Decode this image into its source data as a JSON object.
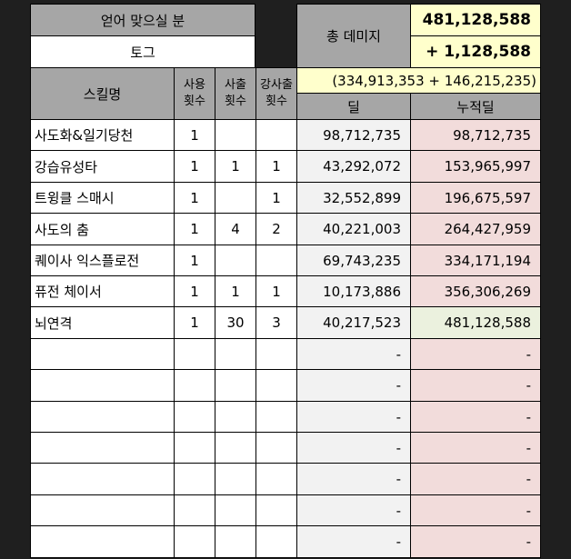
{
  "top_left": {
    "title": "얻어 맞으실 분",
    "name": "토그"
  },
  "summary": {
    "total_label": "총 데미지",
    "total_value": "481,128,588",
    "delta_value": "+ 1,128,588",
    "breakdown": "(334,913,353 + 146,215,235)"
  },
  "headers": {
    "skill": "스킬명",
    "use_line1": "사용",
    "use_line2": "횟수",
    "cast_line1": "사출",
    "cast_line2": "횟수",
    "strong_line1": "강사출",
    "strong_line2": "횟수",
    "deal": "딜",
    "cumulative": "누적딜"
  },
  "rows": [
    {
      "skill": "사도화&일기당천",
      "use": "1",
      "cast": "",
      "strong": "",
      "deal": "98,712,735",
      "cum": "98,712,735"
    },
    {
      "skill": "강습유성타",
      "use": "1",
      "cast": "1",
      "strong": "1",
      "deal": "43,292,072",
      "cum": "153,965,997"
    },
    {
      "skill": "트윙클 스매시",
      "use": "1",
      "cast": "",
      "strong": "1",
      "deal": "32,552,899",
      "cum": "196,675,597"
    },
    {
      "skill": "사도의 춤",
      "use": "1",
      "cast": "4",
      "strong": "2",
      "deal": "40,221,003",
      "cum": "264,427,959"
    },
    {
      "skill": "퀘이사 익스플로전",
      "use": "1",
      "cast": "",
      "strong": "",
      "deal": "69,743,235",
      "cum": "334,171,194"
    },
    {
      "skill": "퓨전 체이서",
      "use": "1",
      "cast": "1",
      "strong": "1",
      "deal": "10,173,886",
      "cum": "356,306,269"
    },
    {
      "skill": "뇌연격",
      "use": "1",
      "cast": "30",
      "strong": "3",
      "deal": "40,217,523",
      "cum": "481,128,588"
    },
    {
      "skill": "",
      "use": "",
      "cast": "",
      "strong": "",
      "deal": "-",
      "cum": "-"
    },
    {
      "skill": "",
      "use": "",
      "cast": "",
      "strong": "",
      "deal": "-",
      "cum": "-"
    },
    {
      "skill": "",
      "use": "",
      "cast": "",
      "strong": "",
      "deal": "-",
      "cum": "-"
    },
    {
      "skill": "",
      "use": "",
      "cast": "",
      "strong": "",
      "deal": "-",
      "cum": "-"
    },
    {
      "skill": "",
      "use": "",
      "cast": "",
      "strong": "",
      "deal": "-",
      "cum": "-"
    },
    {
      "skill": "",
      "use": "",
      "cast": "",
      "strong": "",
      "deal": "-",
      "cum": "-"
    },
    {
      "skill": "",
      "use": "",
      "cast": "",
      "strong": "",
      "deal": "-",
      "cum": "-"
    }
  ],
  "colors": {
    "header_gray": "#a6a6a6",
    "summary_yellow": "#ffffcc",
    "cumulative_pink": "#f2dcdb",
    "cumulative_last_green": "#ebf1de",
    "deal_light": "#f2f2f2",
    "background": "#1f1f1f"
  }
}
